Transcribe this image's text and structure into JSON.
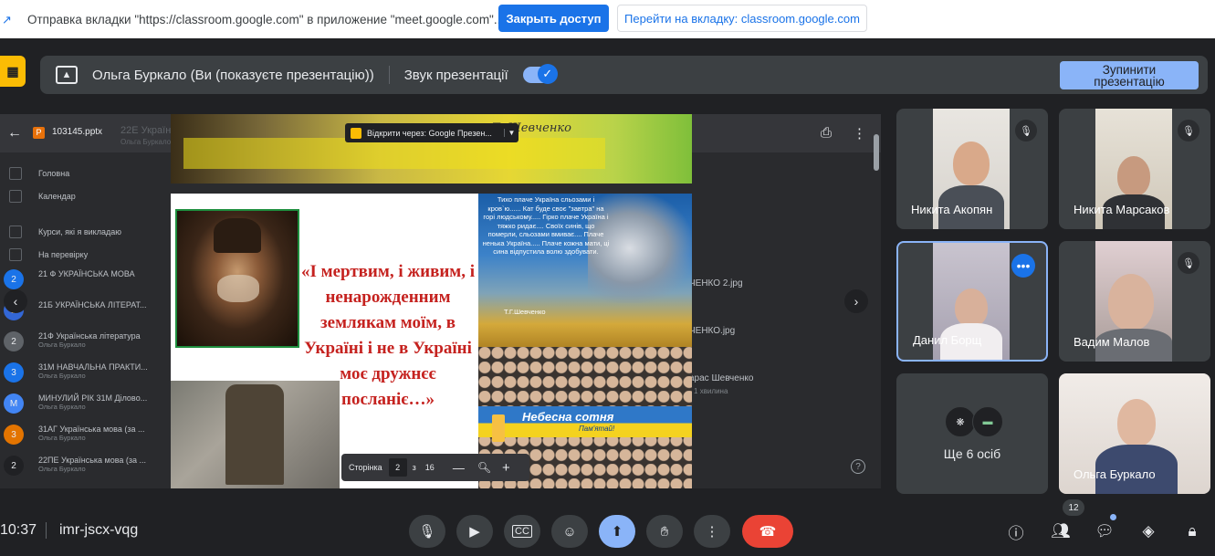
{
  "share_bar": {
    "message": "Отправка вкладки \"https://classroom.google.com\" в приложение \"meet.google.com\"...",
    "close_access": "Закрыть доступ",
    "go_to_tab": "Перейти на вкладку: classroom.google.com"
  },
  "presenting_bar": {
    "presenter": "Ольга Буркало (Ви (показуєте презентацію))",
    "sound_label": "Звук презентації",
    "sound_on": true,
    "stop_button": "Зупинити презентацію"
  },
  "classroom": {
    "file_name": "103145.pptx",
    "header_ghost_title": "22Е Української",
    "header_ghost_sub": "Ольга Буркало",
    "nav_items": [
      "Головна",
      "Календар",
      "Курси, які я викладаю",
      "На перевірку"
    ],
    "courses": [
      {
        "initial": "2",
        "title": "21 Ф УКРАЇНСЬКА МОВА",
        "sub": "",
        "color": "#1a73e8"
      },
      {
        "initial": "2",
        "title": "21Б УКРАЇНСЬКА ЛІТЕРАТ...",
        "sub": "",
        "color": "#3367d6"
      },
      {
        "initial": "2",
        "title": "21Ф Українська література",
        "sub": "Ольга Буркало",
        "color": "#5f6368"
      },
      {
        "initial": "3",
        "title": "31М НАВЧАЛЬНА ПРАКТИ...",
        "sub": "Ольга Буркало",
        "color": "#1a73e8"
      },
      {
        "initial": "М",
        "title": "МИНУЛИЙ РІК 31М Діловo...",
        "sub": "Ольга Буркало",
        "color": "#4285f4"
      },
      {
        "initial": "3",
        "title": "31АГ Українська мова (за ...",
        "sub": "Ольга Буркало",
        "color": "#e37400"
      },
      {
        "initial": "2",
        "title": "22ПЕ Українська мова (за ...",
        "sub": "Ольга Буркало",
        "color": "#202124"
      }
    ],
    "right_list": [
      {
        "title": "ЧЕНКО 2.jpg",
        "sub": ""
      },
      {
        "title": "ЧЕНКО.jpg",
        "sub": ""
      },
      {
        "title": "арас Шевченко",
        "sub": "• 1 хвилина"
      }
    ]
  },
  "slide": {
    "open_with": "Відкрити через: Google Презен...",
    "signature": "Т. Шевченко",
    "quote": "«І мертвим, і живим, і ненарожденним землякам моїм, в Україні і не в Україні моє дружнєє посланіє…»",
    "poem": "Тихо плаче Україна сльозами і кров`ю...... Кат буде своє \"завтра\" на горі людському..... Гірко плаче Україна і тяжко ридає.... Своїх синів, що померли, сльозами вмиває.... Плаче ненька Україна..... Плаче кожна мати, ці сина відпустила волю здобувати.",
    "poem_author": "Т.Г.Шевченко",
    "banner_title": "Небесна сотня",
    "banner_sub": "Пам'ятай!",
    "pager_label": "Сторінка",
    "page": "2",
    "of": "з",
    "total": "16"
  },
  "participants": [
    {
      "name": "Никита Акопян",
      "muted": true
    },
    {
      "name": "Никита Марсаков",
      "muted": true
    },
    {
      "name": "Данил Борщ",
      "muted": false,
      "active": true
    },
    {
      "name": "Вадим Малов",
      "muted": true
    },
    {
      "name": "Ще 6 осіб",
      "muted": false
    },
    {
      "name": "Ольга Буркало",
      "muted": false
    }
  ],
  "bottom": {
    "time": "10:37",
    "meeting_code": "imr-jscx-vqg",
    "people_count": "12"
  },
  "colors": {
    "background": "#202124",
    "accent_blue": "#1a73e8",
    "light_blue": "#8ab4f8",
    "end_call_red": "#ea4335"
  }
}
